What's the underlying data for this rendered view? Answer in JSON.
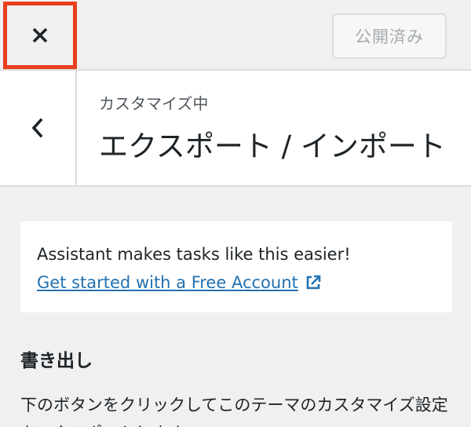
{
  "header": {
    "close_icon": "close-icon",
    "publish_label": "公開済み"
  },
  "section": {
    "back_icon": "chevron-left-icon",
    "subtitle": "カスタマイズ中",
    "title": "エクスポート / インポート"
  },
  "notice": {
    "text": "Assistant makes tasks like this easier!",
    "link_label": "Get started with a Free Account",
    "link_icon": "external-link-icon",
    "link_color": "#2271b1"
  },
  "export": {
    "heading": "書き出し",
    "description": "下のボタンをクリックしてこのテーマのカスタマイズ設定をエクスポートします。"
  },
  "colors": {
    "highlight": "#e8401c",
    "background": "#f0f0f1"
  }
}
